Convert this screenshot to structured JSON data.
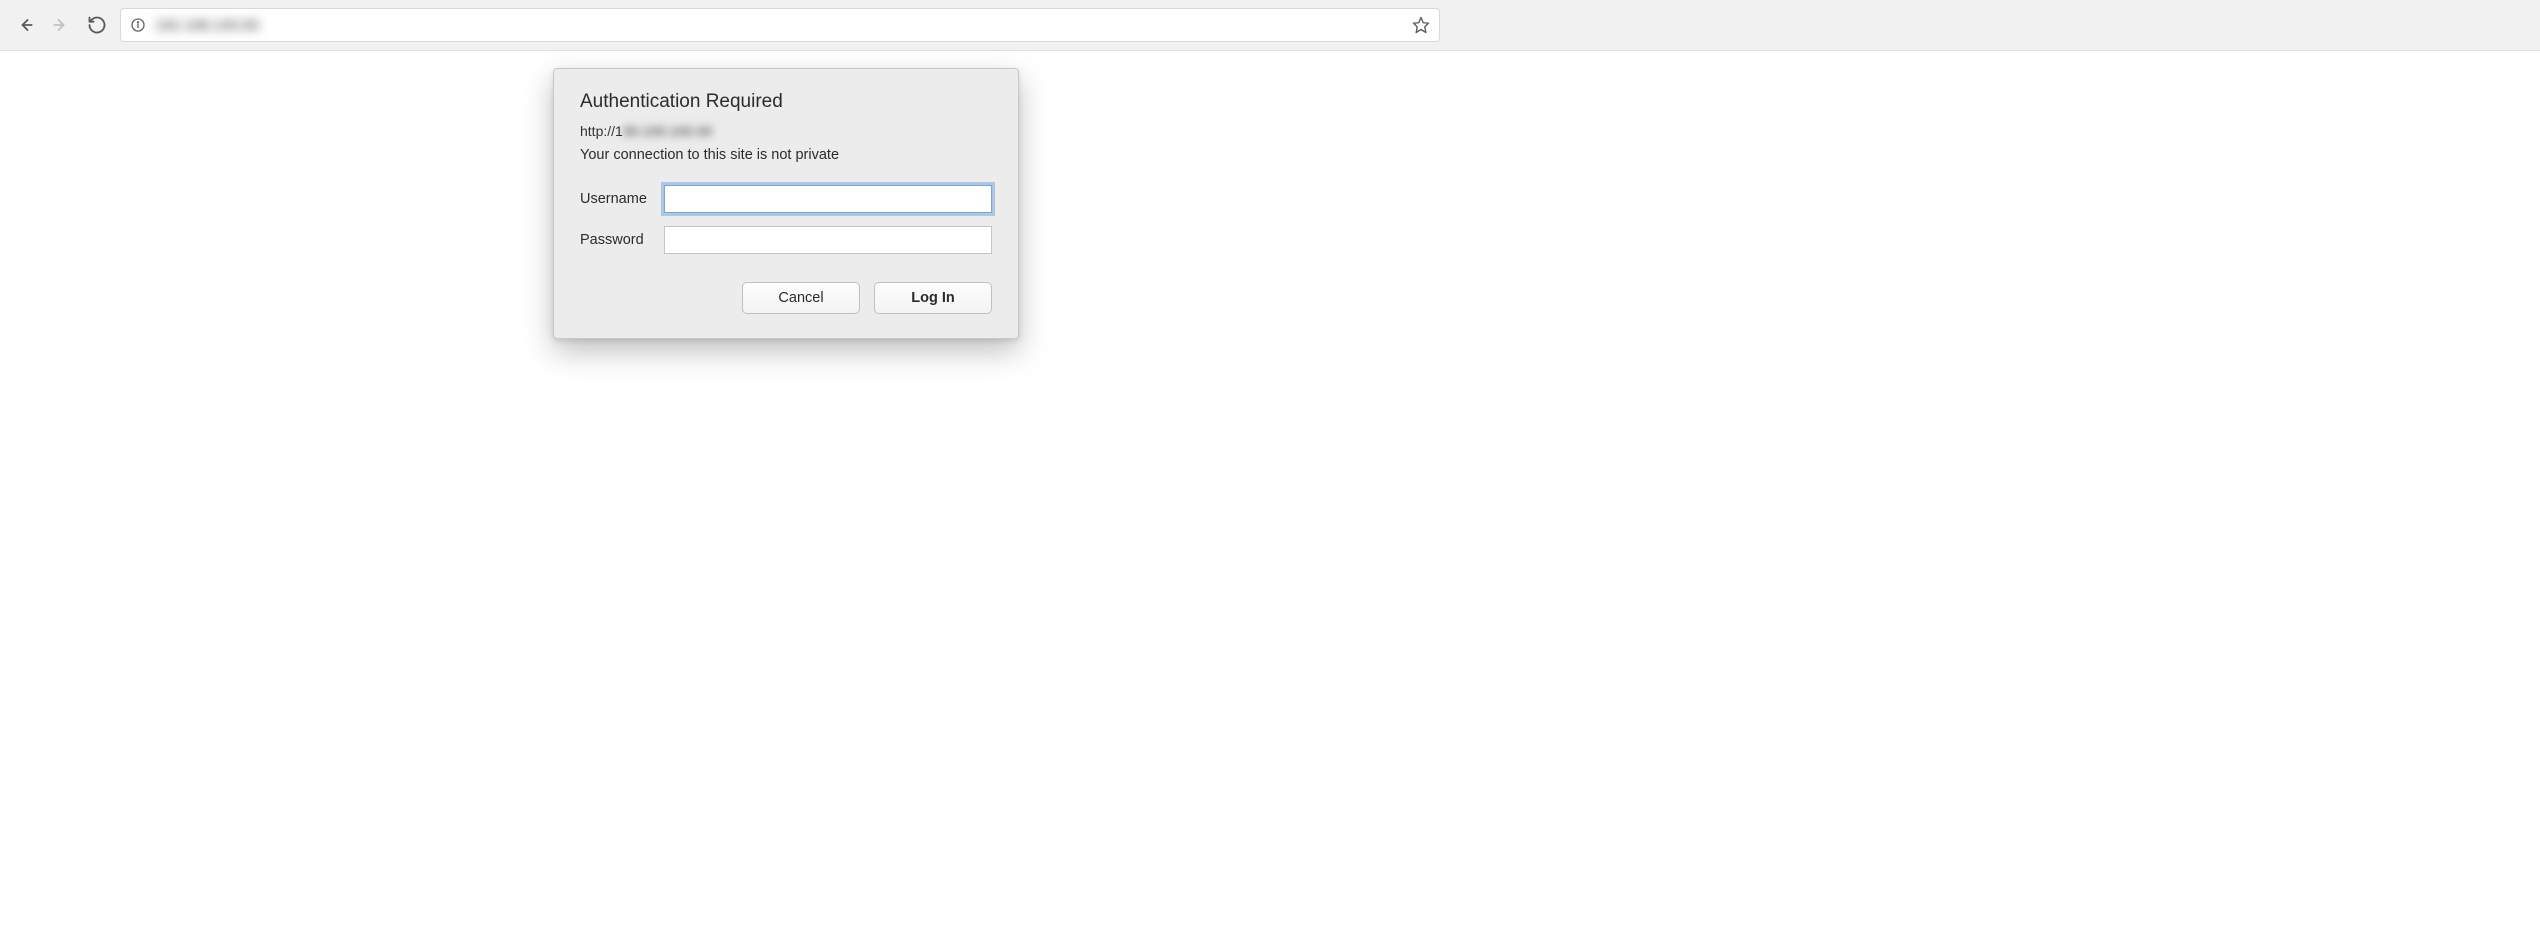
{
  "browser": {
    "url_display": "192.168.100.83"
  },
  "dialog": {
    "title": "Authentication Required",
    "url_prefix": "http://1",
    "url_blurred": "00.100.100.00",
    "warning": "Your connection to this site is not private",
    "username_label": "Username",
    "password_label": "Password",
    "username_value": "",
    "password_value": "",
    "cancel_label": "Cancel",
    "login_label": "Log In"
  }
}
